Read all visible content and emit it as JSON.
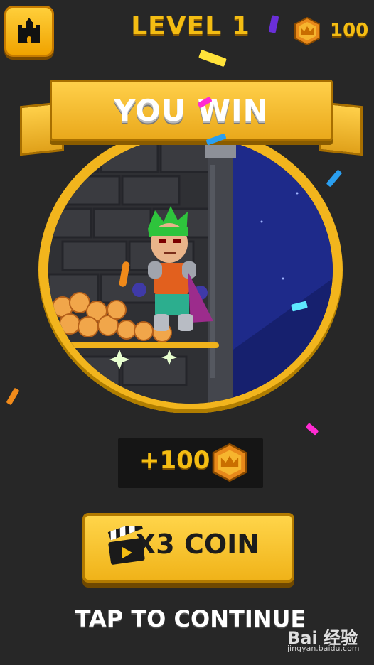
{
  "header": {
    "level_title": "LEVEL 1",
    "coin_count": "100",
    "home_icon": "castle-icon",
    "coin_icon": "crown-coin-icon"
  },
  "banner": {
    "title": "YOU WIN"
  },
  "reward": {
    "amount": "+100",
    "icon": "crown-coin-icon"
  },
  "x3_button": {
    "label": "X3 COIN",
    "icon": "video-clapper-icon"
  },
  "footer": {
    "tap_label": "TAP TO CONTINUE"
  },
  "watermark": {
    "logo": "Bai 经验",
    "url": "jingyan.baidu.com"
  },
  "colors": {
    "background": "#272727",
    "gold": "#f4bd13",
    "button_yellow": "#ffd54a"
  }
}
